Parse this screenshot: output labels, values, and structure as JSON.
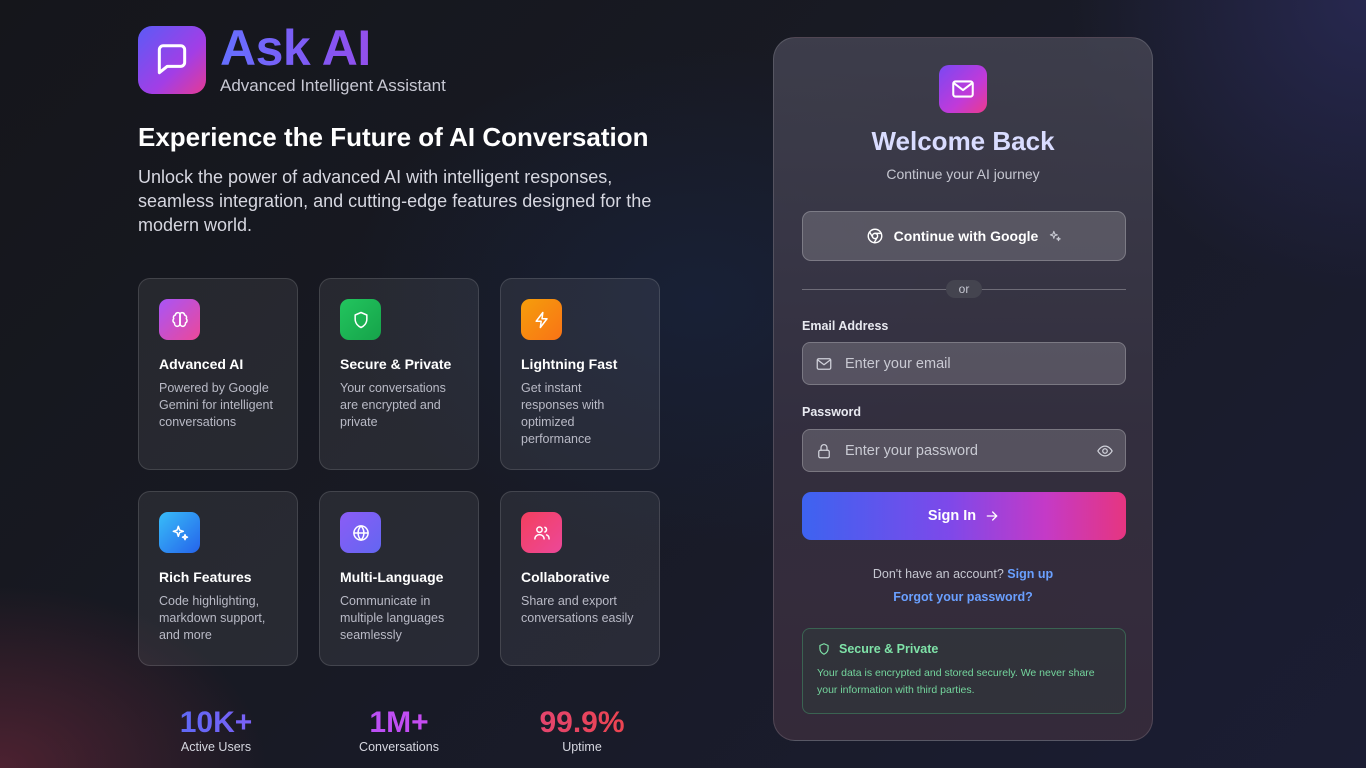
{
  "brand": {
    "name": "Ask AI",
    "tagline": "Advanced Intelligent Assistant"
  },
  "hero": {
    "headline": "Experience the Future of AI Conversation",
    "description": "Unlock the power of advanced AI with intelligent responses, seamless integration, and cutting-edge features designed for the modern world."
  },
  "features": [
    {
      "title": "Advanced AI",
      "description": "Powered by Google Gemini for intelligent conversations",
      "icon": "brain-icon",
      "color": "#c64bd8"
    },
    {
      "title": "Secure & Private",
      "description": "Your conversations are encrypted and private",
      "icon": "shield-icon",
      "color": "#22c55e"
    },
    {
      "title": "Lightning Fast",
      "description": "Get instant responses with optimized performance",
      "icon": "lightning-icon",
      "color": "#f59e0b"
    },
    {
      "title": "Rich Features",
      "description": "Code highlighting, markdown support, and more",
      "icon": "sparkles-icon",
      "color": "#2d9cf0"
    },
    {
      "title": "Multi-Language",
      "description": "Communicate in multiple languages seamlessly",
      "icon": "globe-icon",
      "color": "#8b5cf6"
    },
    {
      "title": "Collaborative",
      "description": "Share and export conversations easily",
      "icon": "users-icon",
      "color": "#ec4899"
    }
  ],
  "stats": [
    {
      "value": "10K+",
      "label": "Active Users"
    },
    {
      "value": "1M+",
      "label": "Conversations"
    },
    {
      "value": "99.9%",
      "label": "Uptime"
    }
  ],
  "login": {
    "title": "Welcome Back",
    "subtitle": "Continue your AI journey",
    "google_label": "Continue with Google",
    "divider_text": "or",
    "email_label": "Email Address",
    "email_placeholder": "Enter your email",
    "email_value": "",
    "password_label": "Password",
    "password_placeholder": "Enter your password",
    "password_value": "",
    "signin_label": "Sign In",
    "no_account_text": "Don't have an account?",
    "signup_link": "Sign up",
    "forgot_link": "Forgot your password?",
    "secure_title": "Secure & Private",
    "secure_text": "Your data is encrypted and stored securely. We never share your information with third parties."
  },
  "colors": {
    "accent_blue": "#6570ff",
    "link": "#6aa0ff",
    "success": "#7fe3a8"
  }
}
